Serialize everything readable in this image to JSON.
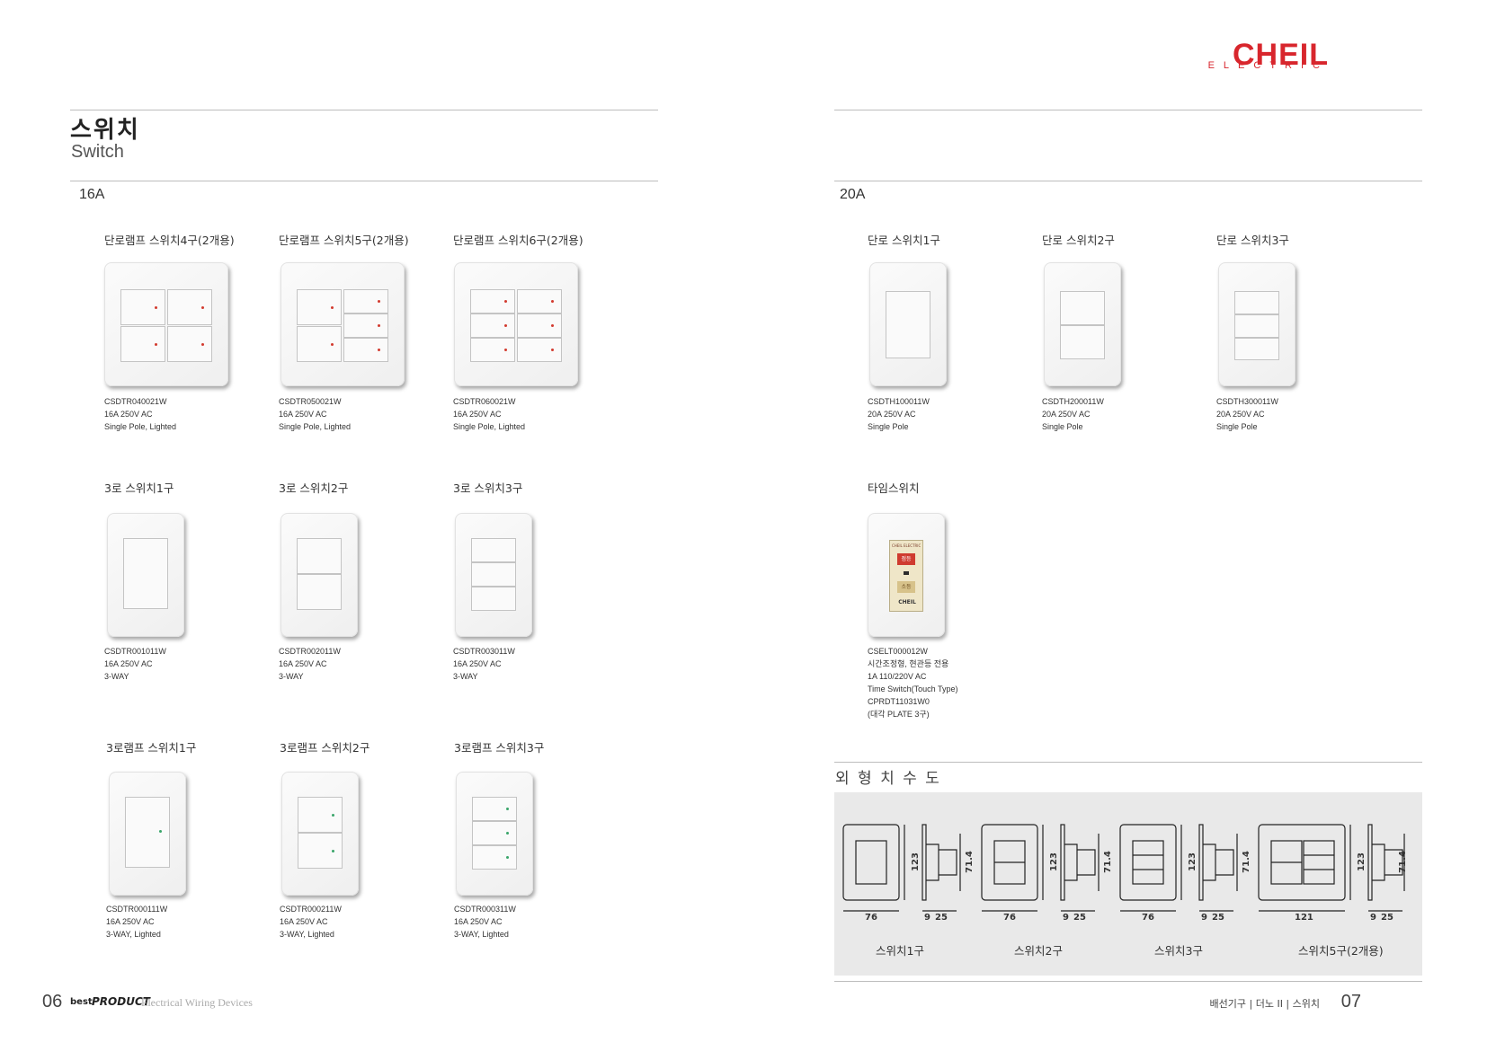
{
  "brand": {
    "name": "CHEIL",
    "sub": "ELECTRIC",
    "color": "#d8262d"
  },
  "header": {
    "title_ko": "스위치",
    "title_en": "Switch"
  },
  "sections": {
    "left": "16A",
    "right": "20A"
  },
  "products": [
    {
      "name": "단로램프 스위치4구(2개용)",
      "specs": [
        "CSDTR040021W",
        "16A 250V AC",
        "Single Pole, Lighted"
      ]
    },
    {
      "name": "단로램프 스위치5구(2개용)",
      "specs": [
        "CSDTR050021W",
        "16A 250V AC",
        "Single Pole, Lighted"
      ]
    },
    {
      "name": "단로램프 스위치6구(2개용)",
      "specs": [
        "CSDTR060021W",
        "16A 250V AC",
        "Single Pole, Lighted"
      ]
    },
    {
      "name": "3로 스위치1구",
      "specs": [
        "CSDTR001011W",
        "16A 250V AC",
        "3-WAY"
      ]
    },
    {
      "name": "3로 스위치2구",
      "specs": [
        "CSDTR002011W",
        "16A 250V AC",
        "3-WAY"
      ]
    },
    {
      "name": "3로 스위치3구",
      "specs": [
        "CSDTR003011W",
        "16A 250V AC",
        "3-WAY"
      ]
    },
    {
      "name": "3로램프 스위치1구",
      "specs": [
        "CSDTR000111W",
        "16A 250V AC",
        "3-WAY, Lighted"
      ]
    },
    {
      "name": "3로램프 스위치2구",
      "specs": [
        "CSDTR000211W",
        "16A 250V AC",
        "3-WAY, Lighted"
      ]
    },
    {
      "name": "3로램프 스위치3구",
      "specs": [
        "CSDTR000311W",
        "16A 250V AC",
        "3-WAY, Lighted"
      ]
    },
    {
      "name": "단로 스위치1구",
      "specs": [
        "CSDTH100011W",
        "20A 250V AC",
        "Single Pole"
      ]
    },
    {
      "name": "단로 스위치2구",
      "specs": [
        "CSDTH200011W",
        "20A 250V AC",
        "Single Pole"
      ]
    },
    {
      "name": "단로 스위치3구",
      "specs": [
        "CSDTH300011W",
        "20A 250V AC",
        "Single Pole"
      ]
    },
    {
      "name": "타임스위치",
      "specs": [
        "CSELT000012W",
        "시간조정형, 현관등 전용",
        "1A 110/220V AC",
        "Time Switch(Touch Type)",
        "CPRDT11031W0",
        "(대각 PLATE 3구)"
      ]
    }
  ],
  "time_switch_face": {
    "brand": "CHEIL",
    "top_label": "CHEIL ELECTRIC",
    "on": "점등",
    "off": "소등"
  },
  "dimension": {
    "title": "외 형 치 수 도",
    "items": [
      {
        "caption": "스위치1구",
        "width": "76",
        "height": "123",
        "inner": "71.4",
        "d1": "9",
        "d2": "25"
      },
      {
        "caption": "스위치2구",
        "width": "76",
        "height": "123",
        "inner": "71.4",
        "d1": "9",
        "d2": "25"
      },
      {
        "caption": "스위치3구",
        "width": "76",
        "height": "123",
        "inner": "71.4",
        "d1": "9",
        "d2": "25"
      },
      {
        "caption": "스위치5구(2개용)",
        "width": "121",
        "height": "123",
        "inner": "71.4",
        "d1": "9",
        "d2": "25"
      }
    ]
  },
  "footer": {
    "left_page": "06",
    "left_brand1": "best",
    "left_brand2": "PRODUCT",
    "left_text": "Electrical Wiring Devices",
    "right_text": "배선기구 | 더노 II | 스위치",
    "right_page": "07"
  },
  "colors": {
    "lamp_red": "#d23a2e",
    "lamp_green": "#3aa56a"
  }
}
